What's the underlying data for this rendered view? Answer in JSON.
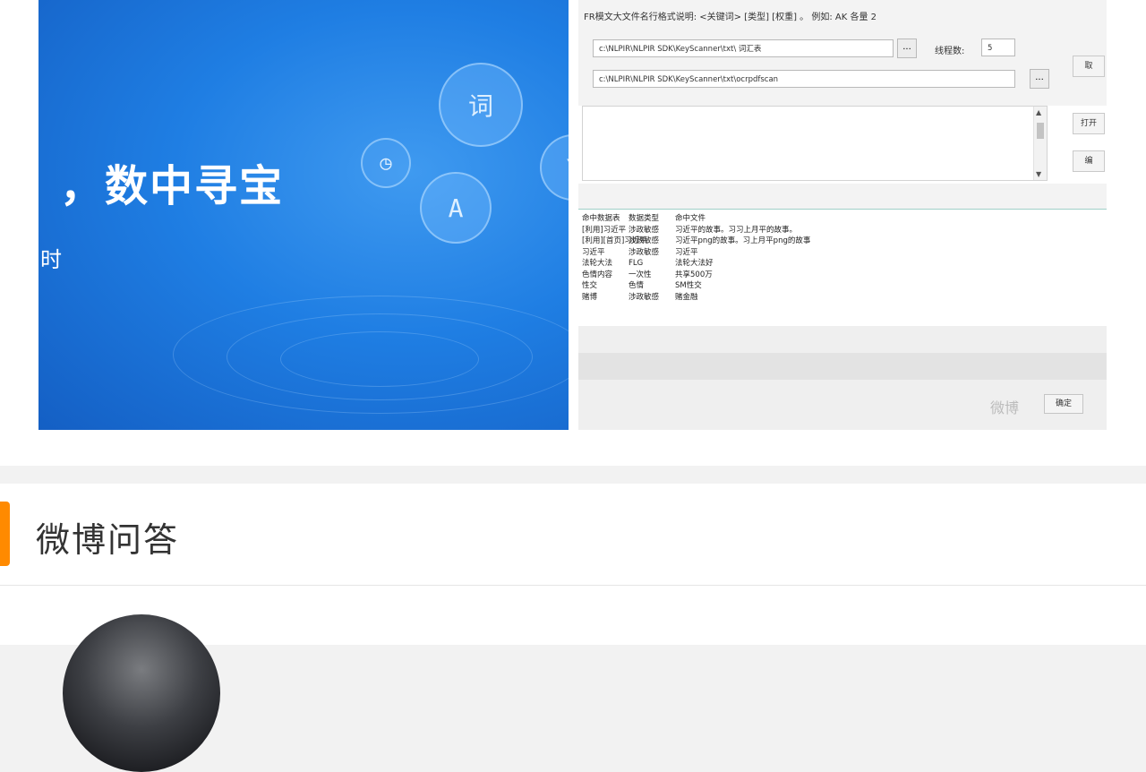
{
  "left_image": {
    "headline": "，数中寻宝",
    "subline": "时",
    "bubble_glyphs": [
      "词",
      "A",
      "◷",
      "Y"
    ],
    "logo": "weibo-logo"
  },
  "right_window": {
    "hint": "FR模文大文件名行格式说明: <关键词> [类型] [权重] 。 例如:  AK 各量 2",
    "path1": "c:\\NLPIR\\NLPIR SDK\\KeyScanner\\txt\\ 词汇表",
    "path2": "c:\\NLPIR\\NLPIR SDK\\KeyScanner\\txt\\ocrpdfscan",
    "dots": "...",
    "thread_label": "线程数:",
    "thread_value": "5",
    "buttons": [
      "取",
      "打开",
      "编"
    ],
    "table_rows": [
      [
        "命中数据表",
        "数据类型",
        "命中文件"
      ],
      [
        "[利用]习近平",
        "涉政敏感",
        "习近平的故事。习习上月平的故事。"
      ],
      [
        "[利用][首页]习近平",
        "涉政敏感",
        "习近平png的故事。习上月平png的故事"
      ],
      [
        "习近平",
        "涉政敏感",
        "习近平"
      ],
      [
        "法轮大法",
        "FLG",
        "法轮大法好"
      ],
      [
        "色情内容",
        "一次性",
        "共享500万"
      ],
      [
        "性交",
        "色情",
        "SM性交"
      ],
      [
        "赌博",
        "涉政敏感",
        "赌金融"
      ]
    ],
    "ok_button": "确定",
    "watermark": "微博"
  },
  "qa": {
    "title": "微博问答"
  }
}
